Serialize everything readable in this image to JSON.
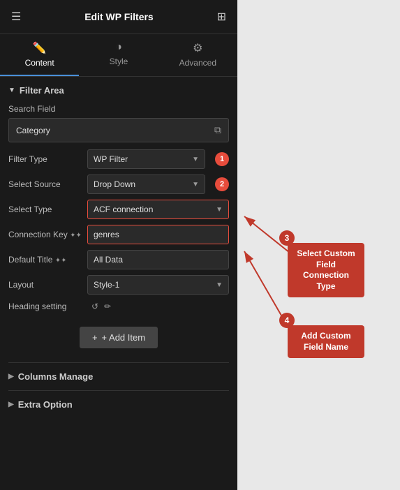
{
  "topbar": {
    "title": "Edit WP Filters",
    "hamburger": "☰",
    "grid": "⊞"
  },
  "tabs": [
    {
      "id": "content",
      "label": "Content",
      "icon": "✏️",
      "active": true
    },
    {
      "id": "style",
      "label": "Style",
      "icon": "◑"
    },
    {
      "id": "advanced",
      "label": "Advanced",
      "icon": "⚙"
    }
  ],
  "filterArea": {
    "sectionLabel": "Filter Area",
    "searchFieldLabel": "Search Field",
    "categoryValue": "Category",
    "formRows": [
      {
        "label": "Filter Type",
        "value": "WP Filter",
        "type": "dropdown",
        "badge": "1"
      },
      {
        "label": "Select Source",
        "value": "Drop Down",
        "type": "dropdown",
        "badge": "2"
      },
      {
        "label": "Select Type",
        "value": "ACF connection",
        "type": "dropdown",
        "badge": null,
        "highlight": true
      },
      {
        "label": "Connection Key",
        "value": "genres",
        "type": "input",
        "badge": null,
        "hasStars": true,
        "highlight": true
      },
      {
        "label": "Default Title",
        "value": "All Data",
        "type": "input",
        "hasStars": true
      },
      {
        "label": "Layout",
        "value": "Style-1",
        "type": "dropdown"
      },
      {
        "label": "Heading setting",
        "value": "",
        "type": "actions"
      }
    ],
    "addItemLabel": "+ Add Item"
  },
  "callouts": [
    {
      "id": "callout3",
      "badge": "3",
      "text": "Select Custom Field Connection Type"
    },
    {
      "id": "callout4",
      "badge": "4",
      "text": "Add Custom Field Name"
    }
  ],
  "collapsibles": [
    {
      "id": "columns",
      "label": "Columns Manage"
    },
    {
      "id": "extra",
      "label": "Extra Option"
    }
  ]
}
